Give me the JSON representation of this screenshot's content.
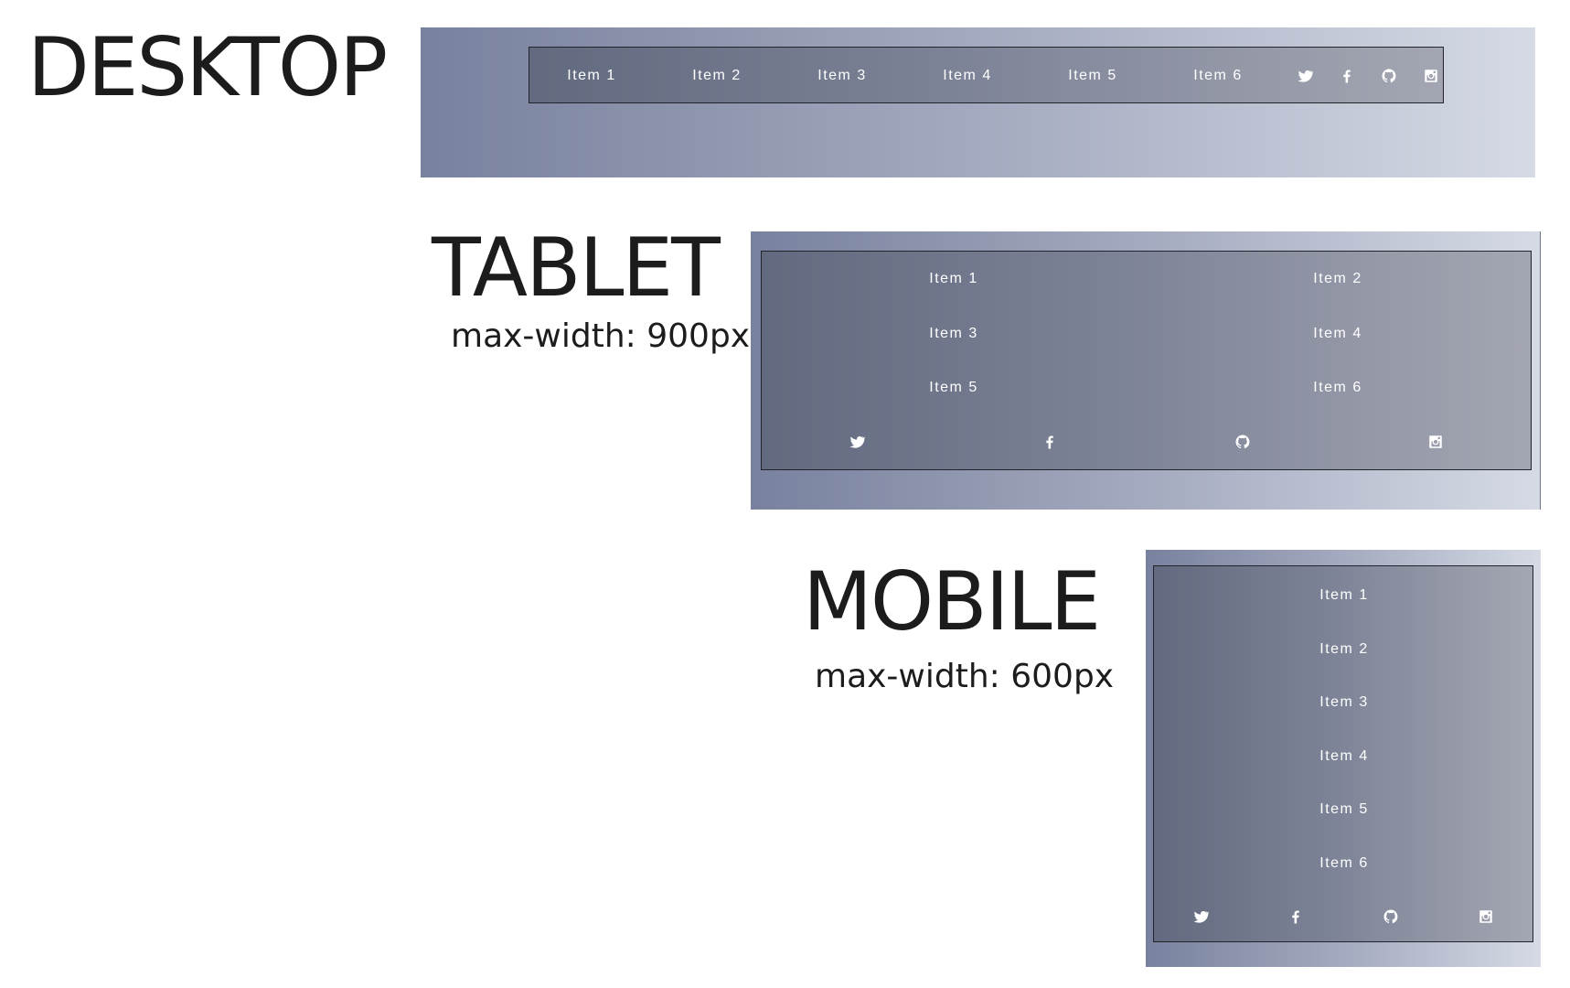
{
  "sections": {
    "desktop": {
      "title": "DESKTOP",
      "items": [
        "Item 1",
        "Item 2",
        "Item 3",
        "Item 4",
        "Item 5",
        "Item 6"
      ]
    },
    "tablet": {
      "title": "TABLET",
      "subtitle": "max-width: 900px",
      "items": [
        "Item 1",
        "Item 2",
        "Item 3",
        "Item 4",
        "Item 5",
        "Item 6"
      ]
    },
    "mobile": {
      "title": "MOBILE",
      "subtitle": "max-width: 600px",
      "items": [
        "Item 1",
        "Item 2",
        "Item 3",
        "Item 4",
        "Item 5",
        "Item 6"
      ]
    }
  },
  "social_icons": [
    "twitter-icon",
    "facebook-icon",
    "github-icon",
    "instagram-icon"
  ],
  "colors": {
    "frame_gradient": [
      "#78819e",
      "#d5dae5"
    ],
    "nav_gradient": [
      "#626a7f",
      "#a3a6b2"
    ],
    "nav_border": "#22242c",
    "nav_text": "#ffffff",
    "heading_text": "#1c1c1c"
  }
}
